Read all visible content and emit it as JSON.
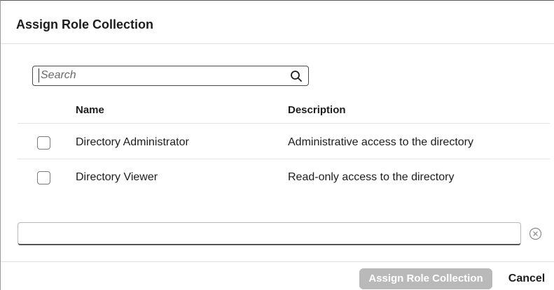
{
  "dialog": {
    "title": "Assign Role Collection"
  },
  "search": {
    "placeholder": "Search",
    "value": "",
    "icon": "search-icon"
  },
  "table": {
    "columns": [
      "Name",
      "Description"
    ],
    "rows": [
      {
        "name": "Directory Administrator",
        "description": "Administrative access to the directory",
        "checked": false
      },
      {
        "name": "Directory Viewer",
        "description": "Read-only access to the directory",
        "checked": false
      }
    ]
  },
  "bottom_input": {
    "value": "",
    "clear_icon": "clear-circle-icon"
  },
  "footer": {
    "primary_label": "Assign Role Collection",
    "cancel_label": "Cancel"
  },
  "colors": {
    "disabled_button": "#b9b9b9",
    "text": "#1d1d1d",
    "divider": "#e3e3e3"
  }
}
